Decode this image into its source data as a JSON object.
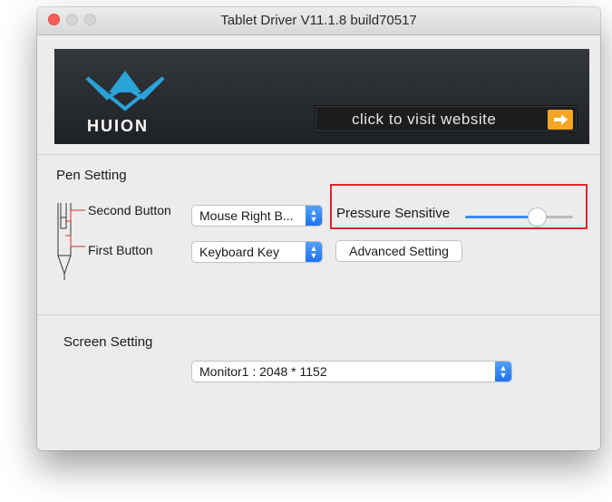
{
  "window": {
    "title": "Tablet Driver V11.1.8 build70517",
    "traffic_lights": [
      "close-button",
      "minimize-button",
      "zoom-button"
    ]
  },
  "banner": {
    "logo_text": "HUION",
    "visit_label": "click to visit website",
    "arrow_icon": "right-arrow-icon",
    "accent_color": "#f6a623"
  },
  "pen_setting": {
    "heading": "Pen Setting",
    "second_button_label": "Second Button",
    "second_button_value": "Mouse Right B...",
    "first_button_label": "First Button",
    "first_button_value": "Keyboard Key",
    "pressure_label": "Pressure Sensitive",
    "pressure_level": 0.7,
    "advanced_label": "Advanced Setting"
  },
  "screen_setting": {
    "heading": "Screen Setting",
    "monitor_value": "Monitor1 : 2048 * 1152"
  },
  "colors": {
    "slider_fill": "#3d8cf5",
    "highlight_box": "#e0242a"
  }
}
